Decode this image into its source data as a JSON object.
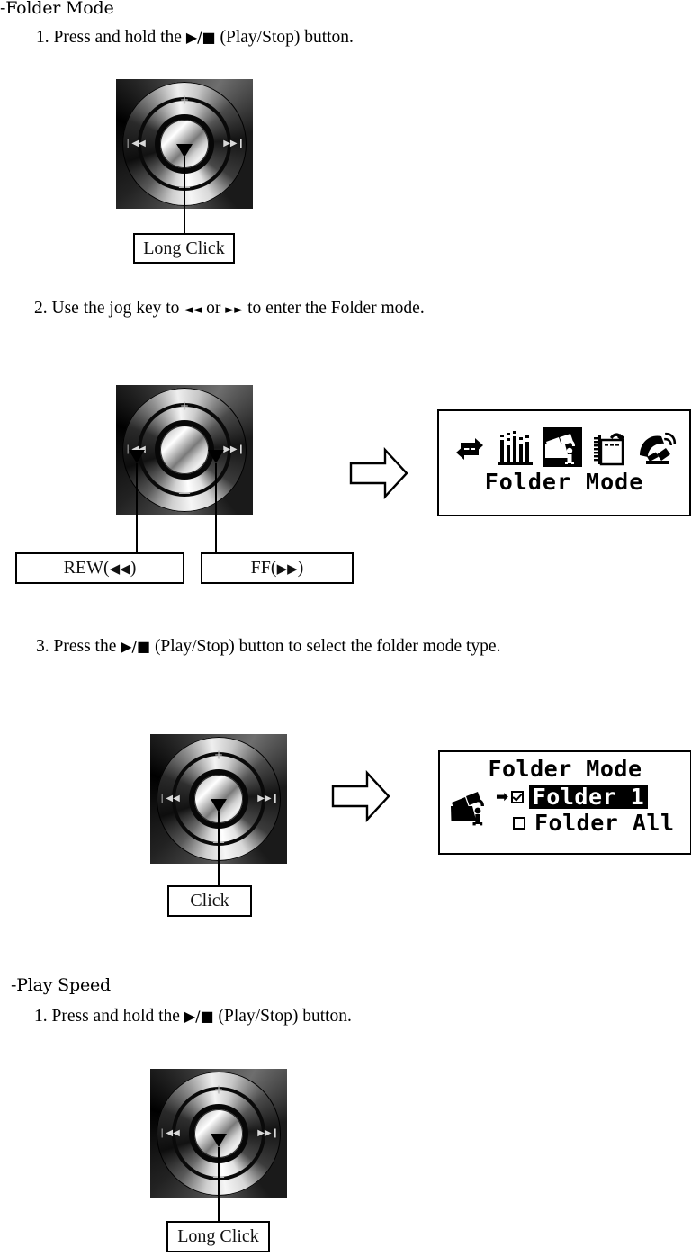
{
  "document": {
    "sections": [
      {
        "id": "folder-mode",
        "header": "-Folder Mode",
        "steps": [
          {
            "num": "1.",
            "pre": "Press and hold the",
            "glyph": "▶/■",
            "post": "(Play/Stop) button."
          },
          {
            "num": "2.",
            "pre": "Use the jog key to",
            "glyph": "◄◄",
            "mid": "or",
            "glyph2": "►►",
            "post": "to enter the Folder mode."
          },
          {
            "num": "3.",
            "pre": "Press the",
            "glyph": "▶/■",
            "post": "(Play/Stop) button to select the folder mode type."
          }
        ]
      },
      {
        "id": "play-speed",
        "header": "-Play Speed",
        "steps": [
          {
            "num": "1.",
            "pre": "Press and hold the",
            "glyph": "▶/■",
            "post": "(Play/Stop) button."
          }
        ]
      }
    ]
  },
  "callouts": {
    "long_click_1": "Long Click",
    "rew": {
      "text": "REW(",
      "arrows": "◀◀",
      "close": ")"
    },
    "ff": {
      "text": "FF(",
      "arrows": "▶▶",
      "close": ")"
    },
    "click": "Click",
    "long_click_2": "Long Click"
  },
  "jog_dial": {
    "notch_top": "+",
    "notch_left": "❘◀◀",
    "notch_right": "▶▶❙",
    "notch_bottom": "──"
  },
  "lcd_folder_mode": {
    "icons": [
      {
        "name": "repeat-one-icon",
        "glyph": "repeat1",
        "selected": false
      },
      {
        "name": "equalizer-icon",
        "glyph": "eq",
        "selected": false
      },
      {
        "name": "folder-icon",
        "glyph": "folder",
        "selected": true
      },
      {
        "name": "notepad-icon",
        "glyph": "notepad",
        "selected": false
      },
      {
        "name": "radio-antenna-icon",
        "glyph": "antenna",
        "selected": false
      }
    ],
    "title": "Folder Mode"
  },
  "lcd_folder_select": {
    "title": "Folder Mode",
    "options": [
      {
        "label": "Folder 1",
        "checked": true,
        "selected": true
      },
      {
        "label": "Folder All",
        "checked": false,
        "selected": false
      }
    ],
    "pointer_arrow": "➡"
  },
  "flow_arrows": {
    "arrow_1": "right-block-arrow",
    "arrow_2": "right-block-arrow"
  }
}
